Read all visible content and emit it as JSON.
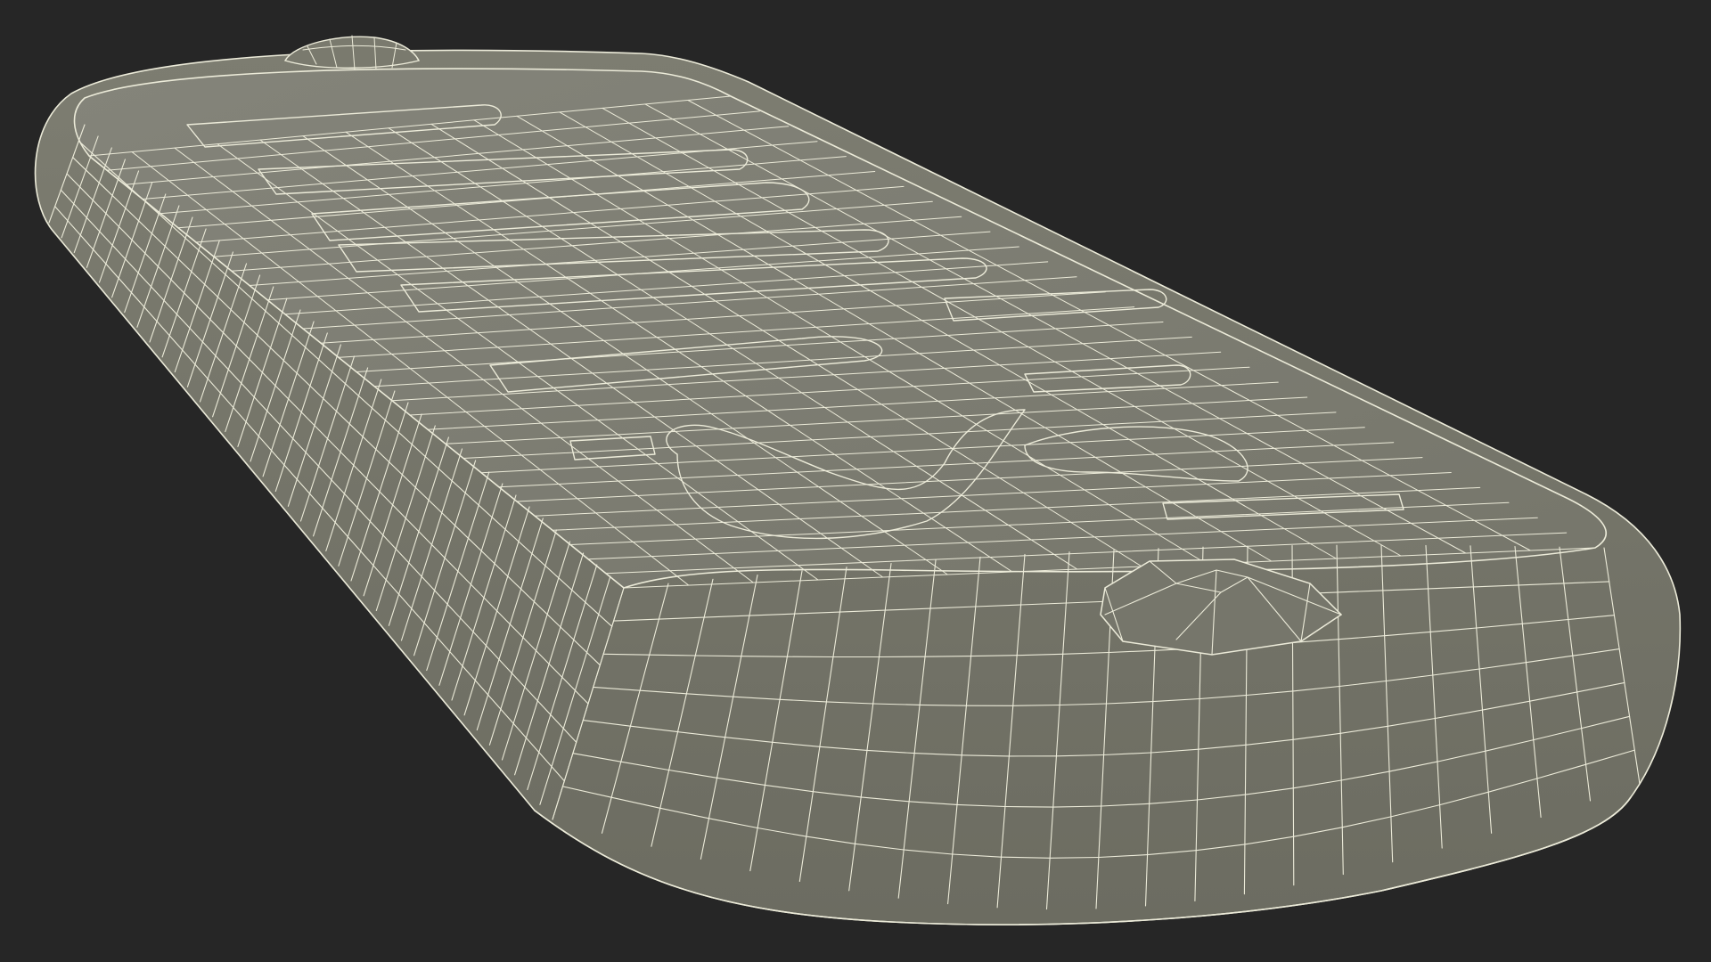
{
  "scene": {
    "subject": "remote-control-wireframe",
    "background_color": "#262626",
    "surface_color": "#7a7a6e",
    "surface_shadow_color": "#65655a",
    "wire_color": "#ecebd9"
  }
}
